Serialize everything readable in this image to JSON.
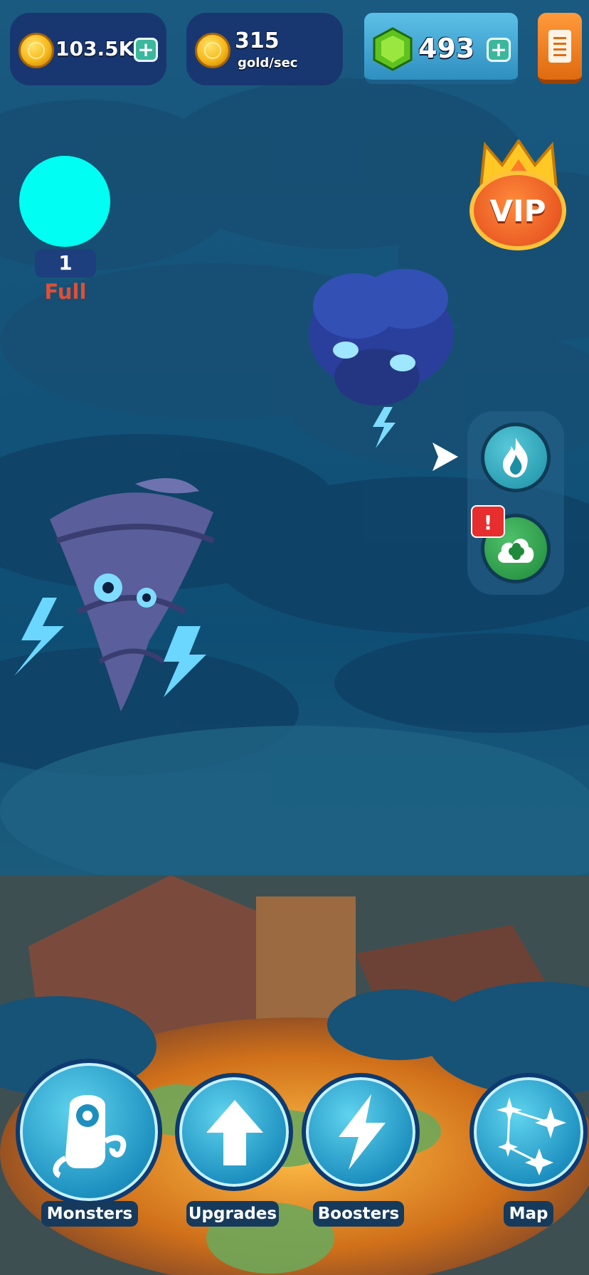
{
  "hud": {
    "gold_amount": "103.5K",
    "gold_rate": "315",
    "gold_rate_unit": "gold/sec",
    "gems": "493"
  },
  "indicator": {
    "level": "1",
    "status": "Full",
    "orb_color": "#00fff2"
  },
  "vip": {
    "label": "VIP"
  },
  "side_panel": {
    "badge": "!"
  },
  "bottom_nav": {
    "monsters": "Monsters",
    "upgrades": "Upgrades",
    "boosters": "Boosters",
    "map": "Map"
  }
}
